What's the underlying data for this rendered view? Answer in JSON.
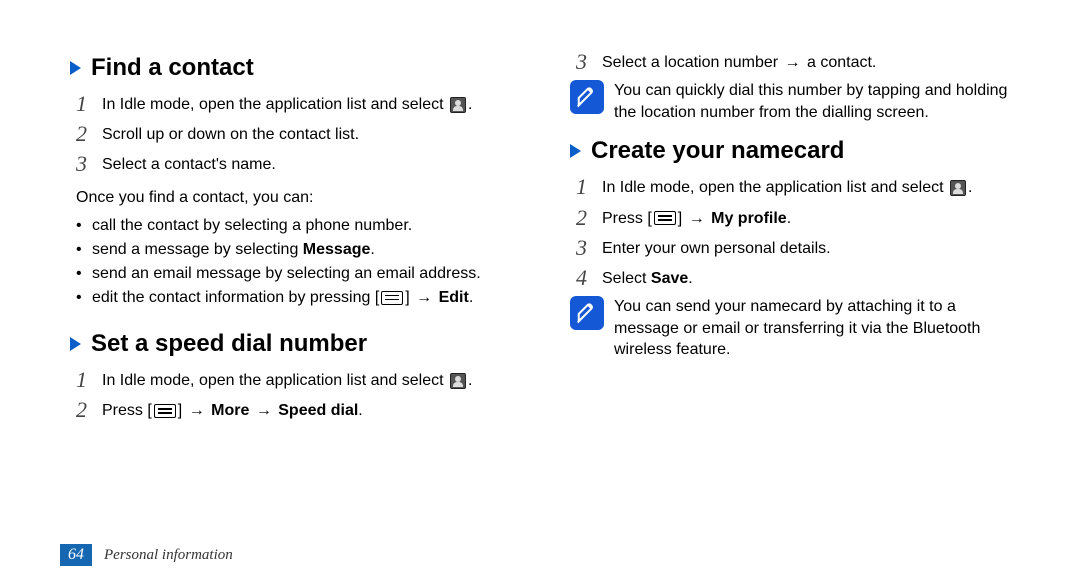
{
  "left": {
    "sec1": {
      "title": "Find a contact",
      "steps": [
        "In Idle mode, open the application list and select",
        "Scroll up or down on the contact list.",
        "Select a contact's name."
      ],
      "after": "Once you find a contact, you can",
      "bullets": {
        "b1": "call the contact by selecting a phone number.",
        "b2_a": "send a message by selecting ",
        "b2_b": "Message",
        "b3": "send an email message by selecting an email address.",
        "b4_a": "edit the contact information by pressing [",
        "b4_b": "] ",
        "b4_arrow": "→",
        "b4_c": " Edit"
      }
    },
    "sec2": {
      "title": "Set a speed dial number",
      "step1": "In Idle mode, open the application list and select",
      "step2_a": "Press [",
      "step2_b": "] ",
      "step2_arrow1": "→",
      "step2_c": " More ",
      "step2_arrow2": "→",
      "step2_d": " Speed dial"
    }
  },
  "right": {
    "step3_a": "Select a location number ",
    "step3_arrow": "→",
    "step3_b": " a contact.",
    "note1": "You can quickly dial this number by tapping and holding the location number from the dialling screen.",
    "sec3": {
      "title": "Create your namecard",
      "step1": "In Idle mode, open the application list and select",
      "step2_a": "Press [",
      "step2_b": "] ",
      "step2_arrow": "→",
      "step2_c": " My profile",
      "step3": "Enter your own personal details.",
      "step4_a": "Select ",
      "step4_b": "Save"
    },
    "note2": "You can send your namecard by attaching it to a message or email or transferring it via the Bluetooth wireless feature."
  },
  "footer": {
    "page": "64",
    "section": "Personal information"
  },
  "punct": {
    "period": ".",
    "colon": ":"
  }
}
